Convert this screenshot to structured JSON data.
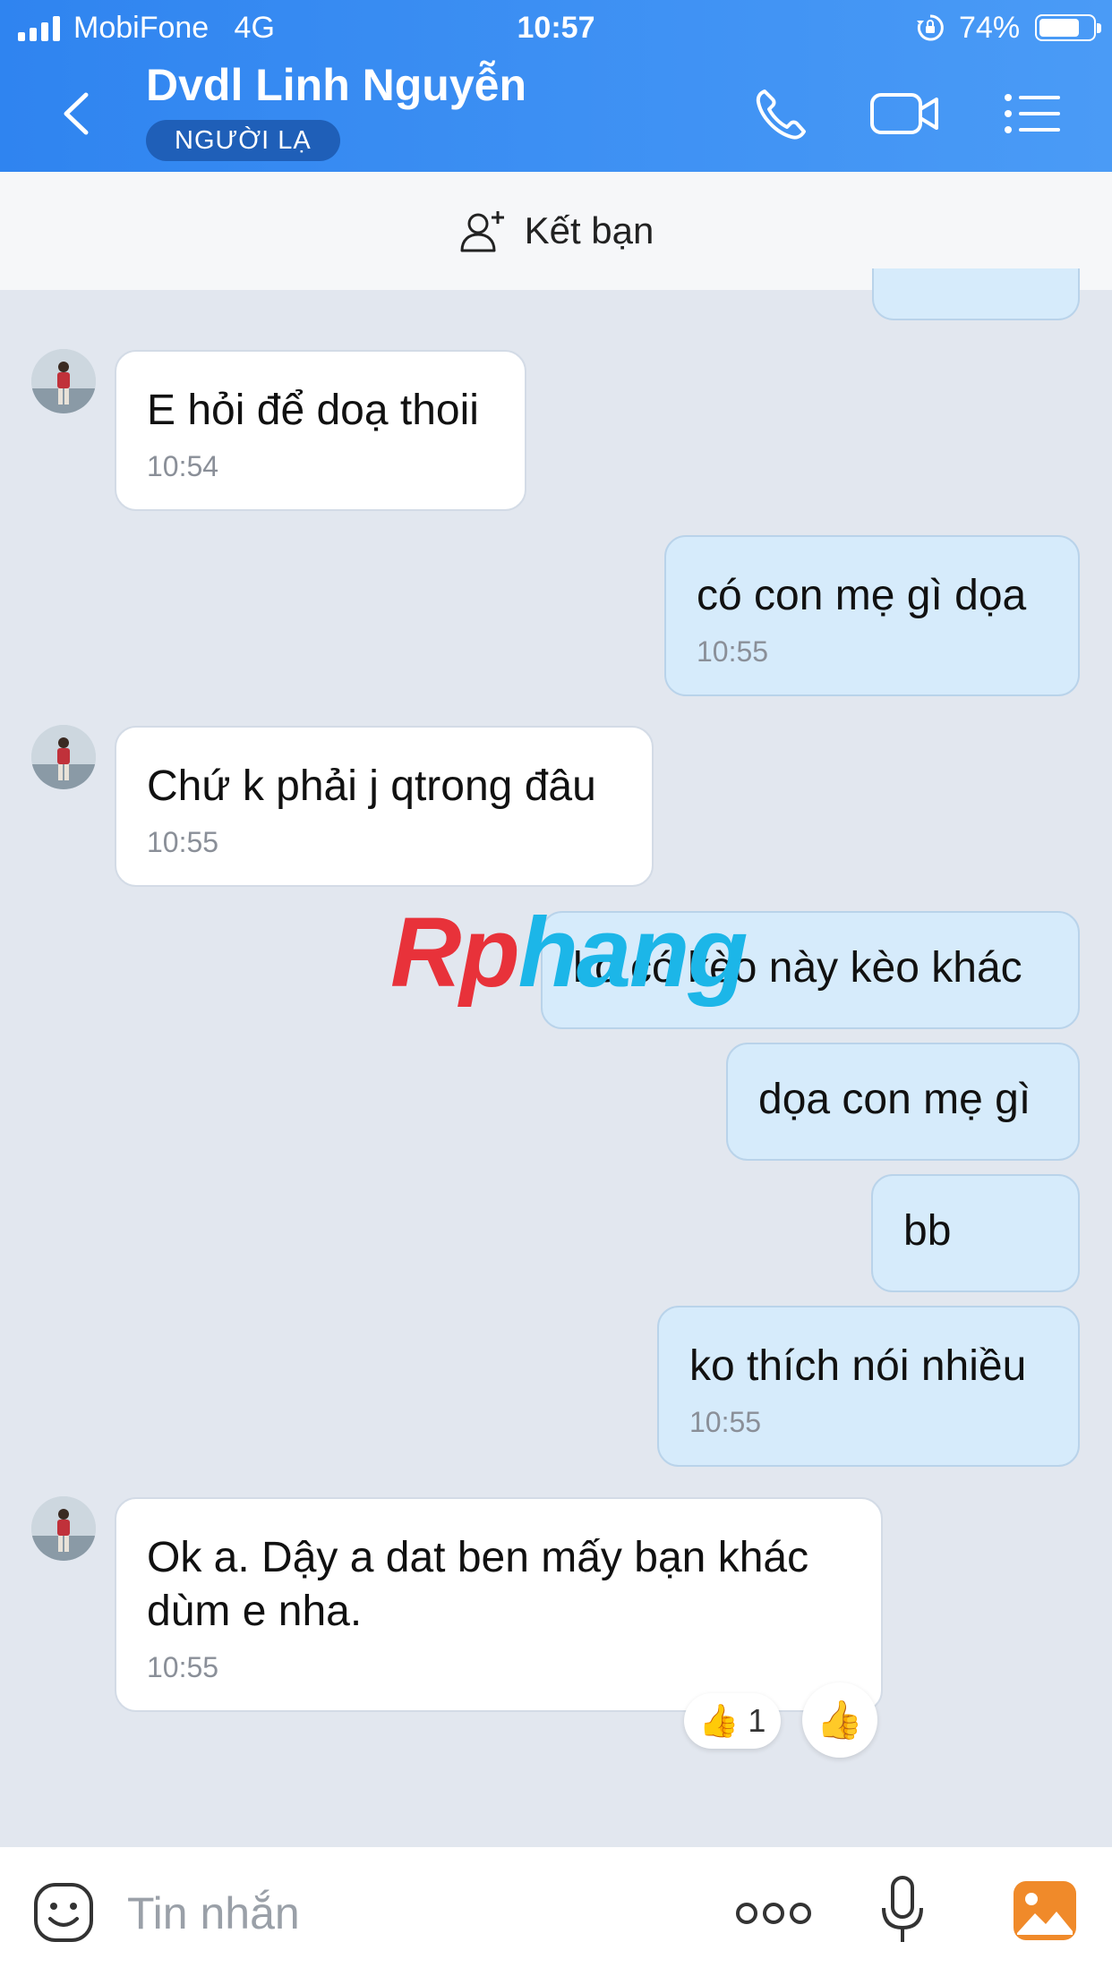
{
  "status_bar": {
    "carrier": "MobiFone",
    "network": "4G",
    "time": "10:57",
    "battery": "74%"
  },
  "header": {
    "contact_name": "Dvdl Linh Nguyễn",
    "badge": "NGƯỜI LẠ",
    "icons": [
      "back-icon",
      "phone-icon",
      "video-icon",
      "menu-icon"
    ]
  },
  "add_friend": {
    "label": "Kết bạn",
    "icon": "add-friend-icon"
  },
  "messages": [
    {
      "direction": "in",
      "text": "E hỏi để doạ thoii",
      "time": "10:54"
    },
    {
      "direction": "out",
      "text": "có con mẹ gì dọa",
      "time": "10:55"
    },
    {
      "direction": "in",
      "text": "Chứ k phải j qtrong đâu",
      "time": "10:55"
    },
    {
      "direction": "out",
      "text": "ko có kèo này kèo khác",
      "time": ""
    },
    {
      "direction": "out",
      "text": "dọa con mẹ gì",
      "time": ""
    },
    {
      "direction": "out",
      "text": "bb",
      "time": ""
    },
    {
      "direction": "out",
      "text": "ko thích nói nhiều",
      "time": "10:55"
    },
    {
      "direction": "in",
      "text": "Ok a. Dậy a dat ben mấy bạn khác dùm e nha.",
      "time": "10:55"
    }
  ],
  "reaction": {
    "icon": "thumbs-up-icon",
    "count": "1"
  },
  "watermark": {
    "part1": "Rp",
    "part2": "hang"
  },
  "composer": {
    "placeholder": "Tin nhắn",
    "icons": [
      "emoji-icon",
      "more-icon",
      "microphone-icon",
      "gallery-icon"
    ]
  },
  "colors": {
    "header": "#3a8ff3",
    "incoming": "#ffffff",
    "outgoing": "#d6ebfb",
    "background": "#e2e7ef"
  }
}
